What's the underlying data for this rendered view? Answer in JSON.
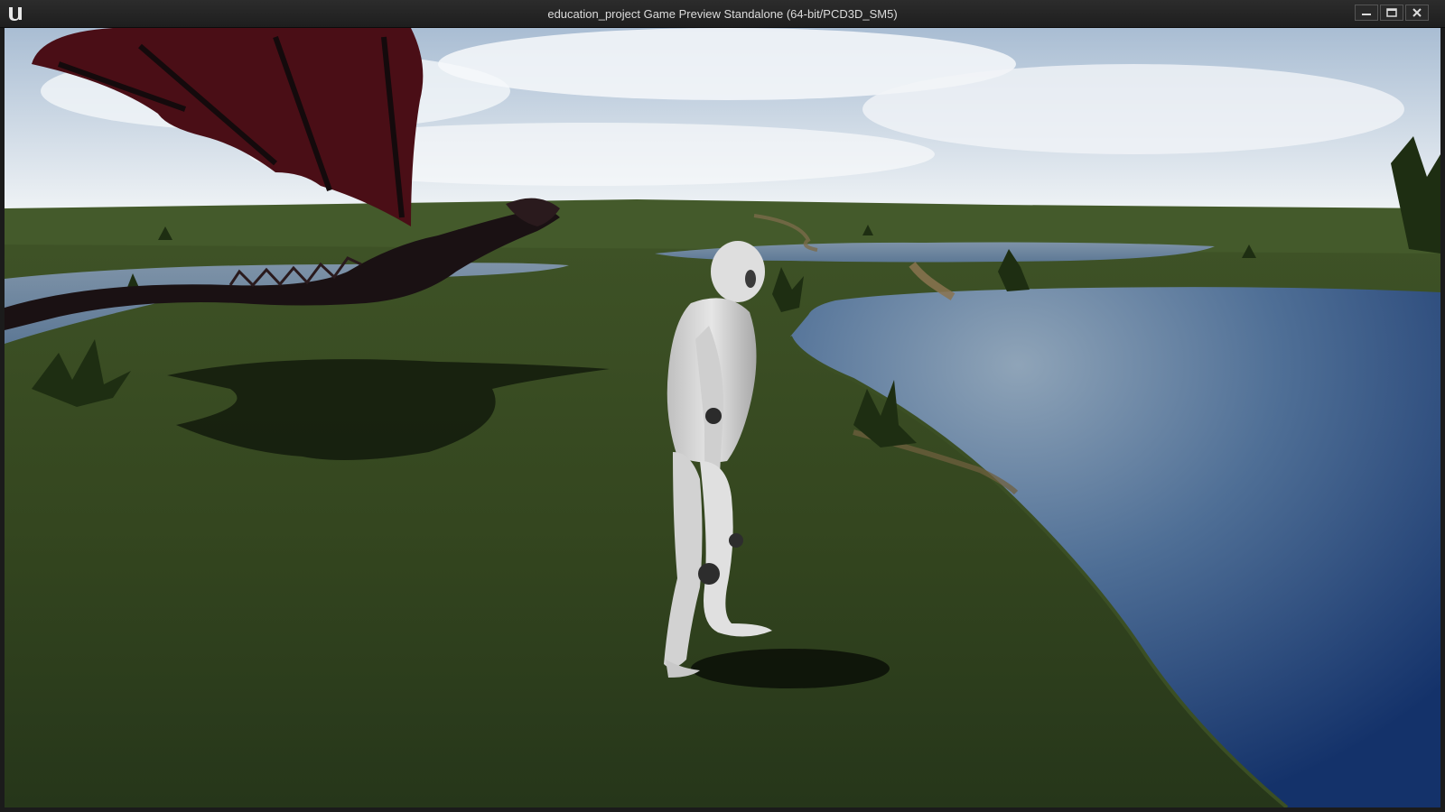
{
  "window": {
    "title": "education_project Game Preview Standalone (64-bit/PCD3D_SM5)",
    "app_icon": "unreal-engine-logo-icon",
    "controls": [
      "minimize-icon",
      "maximize-icon",
      "close-icon"
    ]
  },
  "scene": {
    "description_entities": [
      "sky",
      "grass-terrain",
      "lake",
      "dragon",
      "mannequin-character",
      "fern-plants",
      "dirt-path"
    ],
    "colors": {
      "sky_top": "#b8c8d8",
      "sky_bottom": "#e8eef3",
      "grass_dark": "#2a3a18",
      "grass_light": "#4a5e2c",
      "water_light": "#7a96b0",
      "water_dark": "#1c3a6a",
      "dragon": "#1a1114",
      "dragon_wing": "#4a0f16",
      "mannequin": "#d6d6d6"
    }
  }
}
